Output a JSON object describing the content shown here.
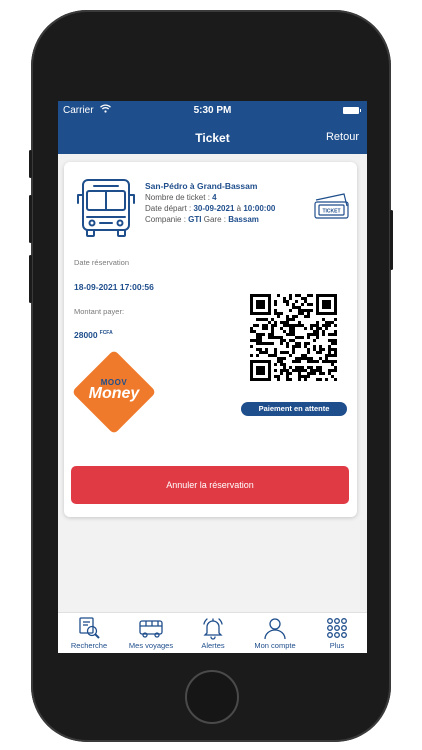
{
  "status_bar": {
    "carrier": "Carrier",
    "time": "5:30 PM"
  },
  "nav": {
    "title": "Ticket",
    "back_label": "Retour"
  },
  "ticket": {
    "route": "San-Pédro à Grand-Bassam",
    "ticket_count_label": "Nombre de ticket :",
    "ticket_count": "4",
    "departure_label": "Date départ :",
    "departure_date": "30-09-2021",
    "departure_sep": "à",
    "departure_time": "10:00:00",
    "company_label": "Companie :",
    "company": "GTI",
    "station_label": "Gare :",
    "station": "Bassam",
    "ticket_icon_text": "TICKET",
    "reservation_date_label": "Date réservation",
    "reservation_date": "18-09-2021 17:00:56",
    "amount_label": "Montant payer:",
    "amount": "28000",
    "currency": "FCFA",
    "payment_provider_line1": "MOOV",
    "payment_provider_line2": "Money",
    "payment_status": "Paiement en attente",
    "cancel_label": "Annuler la réservation"
  },
  "tabs": [
    {
      "label": "Recherche",
      "icon": "search-doc-icon"
    },
    {
      "label": "Mes voyages",
      "icon": "bus-icon"
    },
    {
      "label": "Alertes",
      "icon": "bell-icon"
    },
    {
      "label": "Mon compte",
      "icon": "user-icon"
    },
    {
      "label": "Plus",
      "icon": "grid-dots-icon"
    }
  ],
  "colors": {
    "primary": "#1f4e8c",
    "danger": "#e03a45",
    "moov_orange": "#f07a2c"
  }
}
